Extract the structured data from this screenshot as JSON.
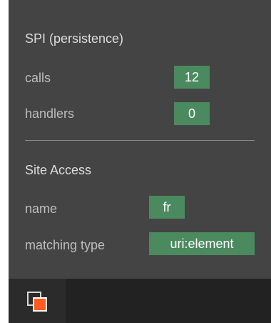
{
  "spi": {
    "title": "SPI (persistence)",
    "calls_label": "calls",
    "calls_value": "12",
    "handlers_label": "handlers",
    "handlers_value": "0"
  },
  "site_access": {
    "title": "Site Access",
    "name_label": "name",
    "name_value": "fr",
    "matching_type_label": "matching type",
    "matching_type_value": "uri:element"
  },
  "toolbar": {
    "toggle_icon": "window-toggle-icon"
  },
  "colors": {
    "panel_bg": "#444444",
    "badge_bg": "#4b8a5f",
    "toolbar_bg": "#222222",
    "icon_accent": "#ff5a1f"
  }
}
